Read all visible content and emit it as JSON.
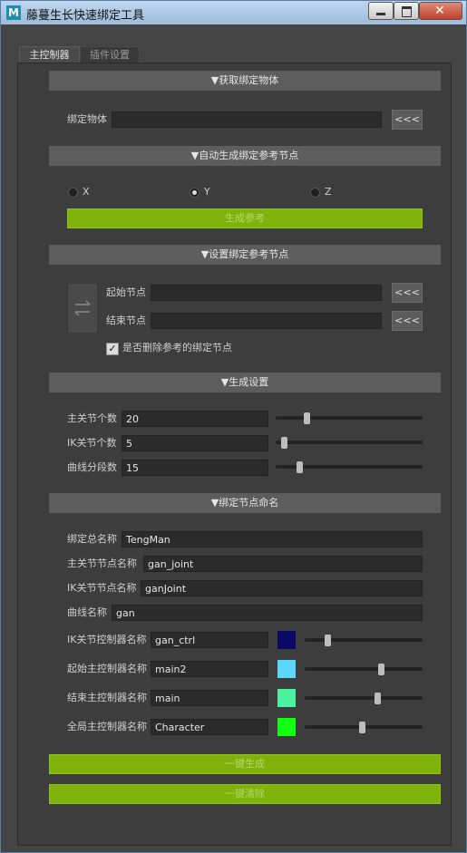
{
  "window": {
    "title": "藤蔓生长快速绑定工具",
    "icon_letter": "M"
  },
  "tabs": [
    {
      "label": "主控制器",
      "active": true
    },
    {
      "label": "插件设置",
      "active": false
    }
  ],
  "get_object": {
    "header": "▼获取绑定物体",
    "label": "绑定物体",
    "value": "",
    "pick_label": "<<<"
  },
  "auto_ref": {
    "header": "▼自动生成绑定参考节点",
    "axes": [
      {
        "label": "X",
        "selected": false
      },
      {
        "label": "Y",
        "selected": true
      },
      {
        "label": "Z",
        "selected": false
      }
    ],
    "button": "生成参考"
  },
  "set_ref": {
    "header": "▼设置绑定参考节点",
    "swap_icon": "swap-arrows-icon",
    "start_label": "起始节点",
    "start_value": "",
    "end_label": "结束节点",
    "end_value": "",
    "pick_label": "<<<",
    "delete_checkbox_label": "是否删除参考的绑定节点",
    "delete_checked": true
  },
  "gen_settings": {
    "header": "▼生成设置",
    "rows": [
      {
        "label": "主关节个数",
        "value": "20",
        "slider": 0.2
      },
      {
        "label": "IK关节个数",
        "value": "5",
        "slider": 0.04
      },
      {
        "label": "曲线分段数",
        "value": "15",
        "slider": 0.15
      }
    ]
  },
  "naming": {
    "header": "▼绑定节点命名",
    "fields": [
      {
        "label": "绑定总名称",
        "value": "TengMan"
      },
      {
        "label": "主关节节点名称",
        "value": "gan_joint"
      },
      {
        "label": "IK关节节点名称",
        "value": "ganJoint"
      },
      {
        "label": "曲线名称",
        "value": "gan"
      }
    ],
    "controllers": [
      {
        "label": "IK关节控制器名称",
        "value": "gan_ctrl",
        "color": "#0a0a66",
        "slider": 0.18
      },
      {
        "label": "起始主控制器名称",
        "value": "main2",
        "color": "#5bd7ff",
        "slider": 0.66
      },
      {
        "label": "结束主控制器名称",
        "value": "main",
        "color": "#4cf2a0",
        "slider": 0.63
      },
      {
        "label": "全局主控制器名称",
        "value": "Character",
        "color": "#11ff11",
        "slider": 0.49
      }
    ]
  },
  "actions": {
    "generate": "一键生成",
    "clear": "一键清除"
  },
  "colors": {
    "accent_green": "#7fb20a",
    "section_header": "#5d5d5d",
    "panel_bg": "#3d3d3d"
  }
}
